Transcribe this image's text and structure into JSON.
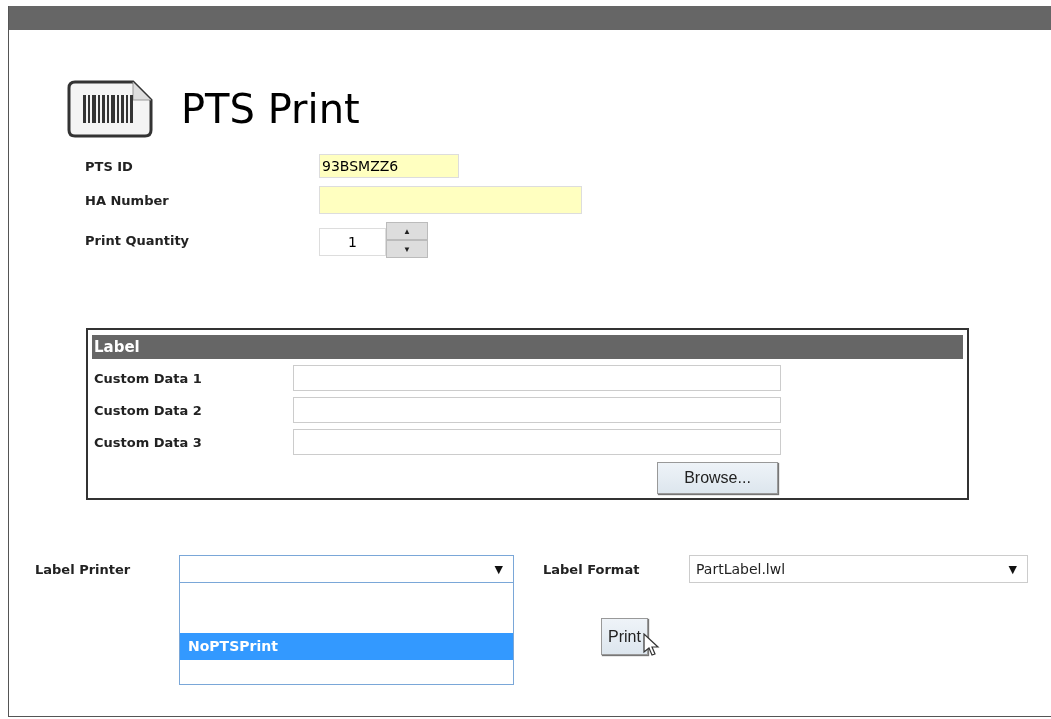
{
  "page": {
    "title": "PTS Print"
  },
  "fields": [
    {
      "label": "PTS ID",
      "value": "93BSMZZ6",
      "kind": "short"
    },
    {
      "label": "HA Number",
      "kind": "long"
    },
    {
      "label": "Print Quantity",
      "value": "1",
      "kind": "spinner",
      "up": "▲",
      "down": "▼"
    }
  ],
  "label_section": {
    "title": "Label",
    "fields": [
      {
        "label": "Custom Data 1"
      },
      {
        "label": "Custom Data 2"
      },
      {
        "label": "Custom Data 3"
      }
    ],
    "browse_button": "Browse..."
  },
  "label_printer": {
    "label": "Label Printer",
    "arrow": "▼",
    "expanded": true,
    "options": [
      {
        "text": "NoPTSPrint",
        "selected": true
      }
    ]
  },
  "label_format": {
    "label": "Label Format",
    "value": "PartLabel.lwl",
    "arrow": "▼"
  },
  "print_button": "Print"
}
